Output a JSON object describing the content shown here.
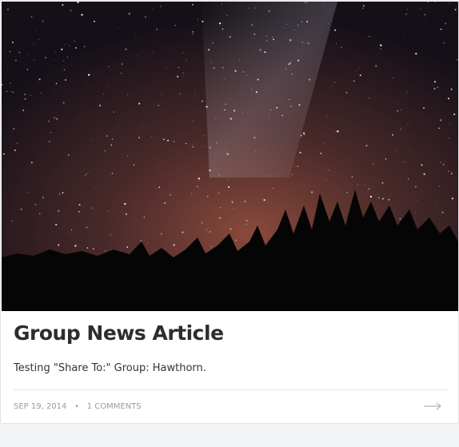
{
  "article": {
    "title": "Group News Article",
    "excerpt": "Testing \"Share To:\" Group: Hawthorn.",
    "date": "SEP 19, 2014",
    "separator": "•",
    "comments": "1 COMMENTS"
  },
  "icons": {
    "read_more": "arrow-right-icon"
  }
}
